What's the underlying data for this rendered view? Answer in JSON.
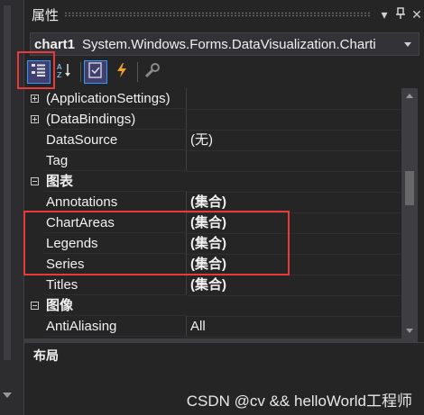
{
  "window": {
    "title": "属性",
    "dropdown_glyph": "▾",
    "pin_glyph": "ᚹ",
    "close_glyph": "✕"
  },
  "selector": {
    "object_name": "chart1",
    "object_type": "System.Windows.Forms.DataVisualization.Charti"
  },
  "toolbar": {
    "buttons": [
      {
        "icon": "categorized-icon",
        "active": true
      },
      {
        "icon": "alphabetical-icon",
        "active": false
      },
      {
        "icon": "properties-icon",
        "active": true
      },
      {
        "icon": "events-icon",
        "active": false
      },
      {
        "icon": "property-pages-icon",
        "active": false
      }
    ]
  },
  "grid": {
    "rows": [
      {
        "type": "expandable",
        "name": "(ApplicationSettings)",
        "value": ""
      },
      {
        "type": "expandable",
        "name": "(DataBindings)",
        "value": ""
      },
      {
        "type": "prop",
        "name": "DataSource",
        "value": "(无)",
        "bold": false
      },
      {
        "type": "prop",
        "name": "Tag",
        "value": "",
        "bold": false
      },
      {
        "type": "category",
        "name": "图表"
      },
      {
        "type": "prop",
        "name": "Annotations",
        "value": "(集合)",
        "bold": true
      },
      {
        "type": "prop",
        "name": "ChartAreas",
        "value": "(集合)",
        "bold": true
      },
      {
        "type": "prop",
        "name": "Legends",
        "value": "(集合)",
        "bold": true
      },
      {
        "type": "prop",
        "name": "Series",
        "value": "(集合)",
        "bold": true
      },
      {
        "type": "prop",
        "name": "Titles",
        "value": "(集合)",
        "bold": true
      },
      {
        "type": "category",
        "name": "图像"
      },
      {
        "type": "prop",
        "name": "AntiAliasing",
        "value": "All",
        "bold": false
      }
    ]
  },
  "description": {
    "title": "布局"
  },
  "watermark": "CSDN @cv && helloWorld工程师",
  "colors": {
    "highlight": "#e83a3a",
    "background": "#252526",
    "accent": "#3399ff"
  }
}
